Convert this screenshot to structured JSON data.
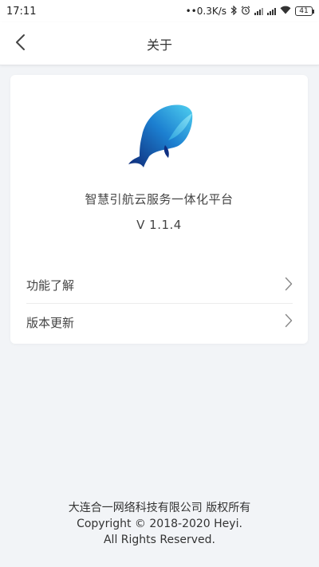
{
  "status_bar": {
    "time": "17:11",
    "network_speed": "0.3K/s",
    "battery": "41",
    "icons": [
      "bluetooth-icon",
      "alarm-icon",
      "cell-signal-icon",
      "cell-signal-icon",
      "wifi-icon",
      "battery-icon"
    ]
  },
  "header": {
    "title": "关于",
    "back_icon": "chevron-left-icon"
  },
  "about": {
    "logo": "whale-logo",
    "app_name": "智慧引航云服务一体化平台",
    "version": "V 1.1.4"
  },
  "menu": {
    "items": [
      {
        "label": "功能了解",
        "icon": "chevron-right-icon"
      },
      {
        "label": "版本更新",
        "icon": "chevron-right-icon"
      }
    ]
  },
  "footer": {
    "company": "大连合一网络科技有限公司 版权所有",
    "copyright": "Copyright © 2018-2020 Heyi.",
    "rights": "All Rights Reserved."
  },
  "colors": {
    "background": "#f2f4f7",
    "card": "#ffffff",
    "logo_light": "#3fc3ee",
    "logo_dark": "#0e2a78"
  }
}
